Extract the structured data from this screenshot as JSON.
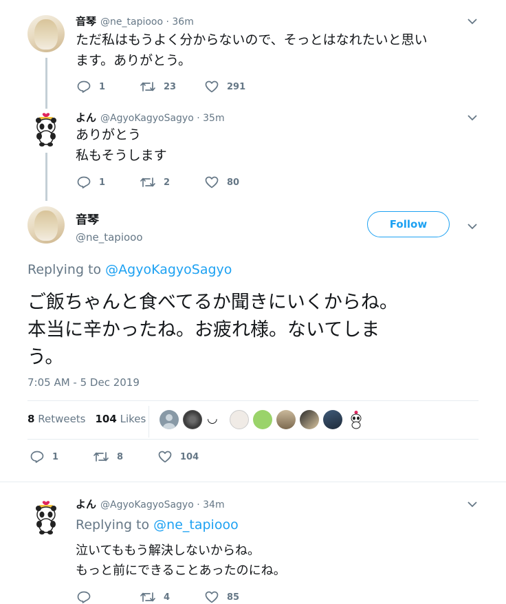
{
  "tweet1": {
    "name": "音琴",
    "handle": "@ne_tapiooo · 36m",
    "line1": "ただ私はもうよく分からないので、そっとはなれたいと思い",
    "line2": "ます。ありがとう。",
    "replies": "1",
    "retweets": "23",
    "likes": "291"
  },
  "tweet2": {
    "name": "よん",
    "handle": "@AgyoKagyoSagyo · 35m",
    "line1": "ありがとう",
    "line2": "私もそうします",
    "replies": "1",
    "retweets": "2",
    "likes": "80"
  },
  "main": {
    "name": "音琴",
    "handle": "@ne_tapiooo",
    "follow_label": "Follow",
    "replying_prefix": "Replying to",
    "replying_to": "@AgyoKagyoSagyo",
    "line1": "ご飯ちゃんと食べてるか聞きにいくからね。",
    "line2": "本当に辛かったね。お疲れ様。ないてしま",
    "line3": "う。",
    "timestamp": "7:05 AM - 5 Dec 2019",
    "retweets_count": "8",
    "retweets_label": "Retweets",
    "likes_count": "104",
    "likes_label": "Likes",
    "smile": "◡",
    "replies": "1",
    "retweets": "8",
    "likes": "104"
  },
  "tweet3": {
    "name": "よん",
    "handle": "@AgyoKagyoSagyo · 34m",
    "replying_prefix": "Replying to",
    "replying_to": "@ne_tapiooo",
    "line1": "泣いてももう解決しないからね。",
    "line2": "もっと前にできることあったのにね。",
    "retweets": "4",
    "likes": "85"
  },
  "icons": {
    "reply": "reply-icon",
    "retweet": "retweet-icon",
    "like": "heart-icon",
    "more": "chevron-down-icon"
  },
  "colors": {
    "link": "#1da1f2",
    "secondary": "#657786",
    "text": "#14171a",
    "thread": "#c4cfd6"
  }
}
